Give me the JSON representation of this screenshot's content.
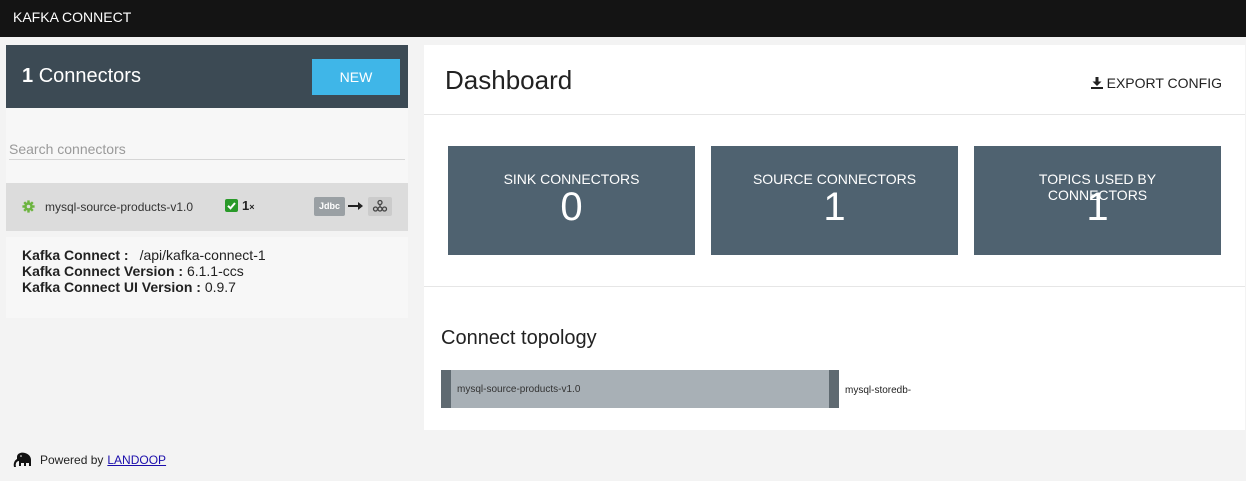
{
  "app": {
    "title": "KAFKA CONNECT"
  },
  "sidebar": {
    "count": "1",
    "count_label": "Connectors",
    "new_button": "NEW",
    "search_placeholder": "Search connectors",
    "connectors": [
      {
        "name": "mysql-source-products-v1.0",
        "tasks": "1",
        "tasks_suffix": "×",
        "source_badge": "Jdbc",
        "status": "running"
      }
    ],
    "info": {
      "connect_label": "Kafka Connect :",
      "connect_value": "/api/kafka-connect-1",
      "version_label": "Kafka Connect Version :",
      "version_value": "6.1.1-ccs",
      "ui_version_label": "Kafka Connect UI Version :",
      "ui_version_value": "0.9.7"
    }
  },
  "main": {
    "title": "Dashboard",
    "export_label": "EXPORT CONFIG",
    "stats": [
      {
        "label": "SINK CONNECTORS",
        "value": "0"
      },
      {
        "label": "SOURCE CONNECTORS",
        "value": "1"
      },
      {
        "label": "TOPICS USED BY CONNECTORS",
        "value": "1"
      }
    ],
    "topology": {
      "title": "Connect topology",
      "source": "mysql-source-products-v1.0",
      "target": "mysql-storedb-"
    }
  },
  "footer": {
    "powered_by": "Powered by",
    "link": "LANDOOP"
  },
  "colors": {
    "header": "#141414",
    "sidebar_head": "#3c4a54",
    "accent": "#3fb6e8",
    "card": "#4f6270",
    "status_ok": "#2a9a2a"
  }
}
